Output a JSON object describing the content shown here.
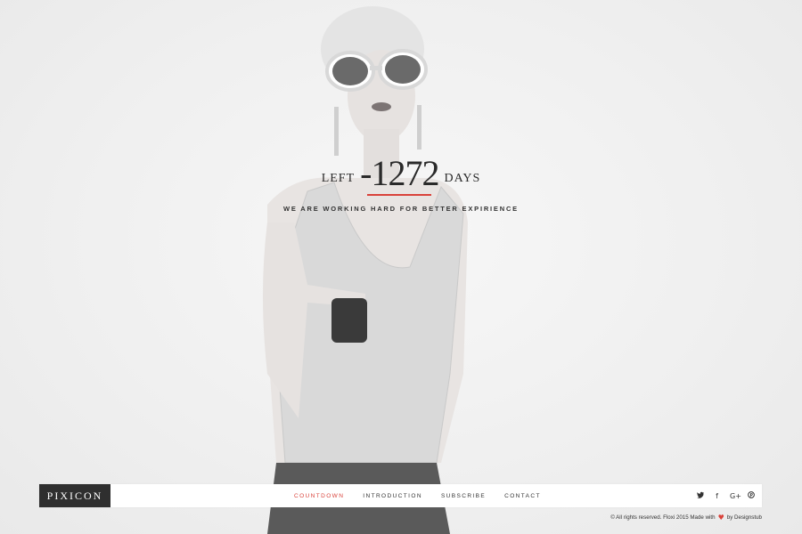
{
  "countdown": {
    "prefix": "LEFT",
    "value": "-1272",
    "suffix": "DAYS",
    "tagline": "WE ARE WORKING HARD FOR BETTER EXPIRIENCE"
  },
  "brand": {
    "logo_text": "PIXICON"
  },
  "nav": {
    "items": [
      {
        "label": "COUNTDOWN",
        "active": true
      },
      {
        "label": "INTRODUCTION",
        "active": false
      },
      {
        "label": "SUBSCRIBE",
        "active": false
      },
      {
        "label": "CONTACT",
        "active": false
      }
    ]
  },
  "social": {
    "twitter": "𝕥",
    "facebook": "f",
    "googleplus": "G+",
    "pinterest": "℗"
  },
  "footer": {
    "copyright": "© All rights reserved. Floxi 2015 Made with",
    "heart": "♥",
    "credit": "by Designstub"
  },
  "colors": {
    "accent": "#d9423a",
    "logo_bg": "#2f2f2f"
  }
}
